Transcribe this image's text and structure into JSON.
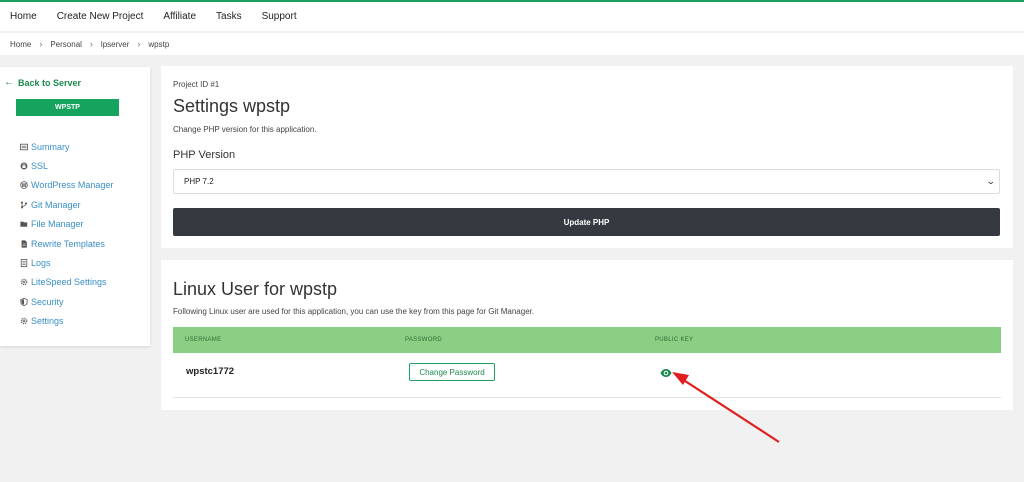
{
  "nav": {
    "items": [
      "Home",
      "Create New Project",
      "Affiliate",
      "Tasks",
      "Support"
    ]
  },
  "breadcrumb": [
    "Home",
    "Personal",
    "lpserver",
    "wpstp"
  ],
  "sidebar": {
    "back_label": "Back to Server",
    "app_badge": "WPSTP",
    "items": [
      {
        "label": "Summary",
        "icon": "list-icon"
      },
      {
        "label": "SSL",
        "icon": "lock-icon"
      },
      {
        "label": "WordPress Manager",
        "icon": "wordpress-icon"
      },
      {
        "label": "Git Manager",
        "icon": "git-branch-icon"
      },
      {
        "label": "File Manager",
        "icon": "folder-open-icon"
      },
      {
        "label": "Rewrite Templates",
        "icon": "file-icon"
      },
      {
        "label": "Logs",
        "icon": "logs-icon"
      },
      {
        "label": "LiteSpeed Settings",
        "icon": "gear-icon"
      },
      {
        "label": "Security",
        "icon": "shield-icon"
      },
      {
        "label": "Settings",
        "icon": "gear-icon"
      }
    ]
  },
  "settings_card": {
    "project_id": "Project ID #1",
    "title": "Settings wpstp",
    "description": "Change PHP version for this application.",
    "php_label": "PHP Version",
    "php_selected": "PHP 7.2",
    "update_button": "Update PHP"
  },
  "linux_card": {
    "title": "Linux User for wpstp",
    "description": "Following Linux user are used for this application, you can use the key from this page for Git Manager.",
    "columns": [
      "USERNAME",
      "PASSWORD",
      "PUBLIC KEY"
    ],
    "rows": [
      {
        "username": "wpstc1772",
        "password_button": "Change Password",
        "public_key_icon": "eye-icon"
      }
    ]
  },
  "colors": {
    "accent": "#1ba261",
    "table_header": "#8bcf85",
    "dark_button": "#343a40",
    "annotation_arrow": "#e02020"
  }
}
